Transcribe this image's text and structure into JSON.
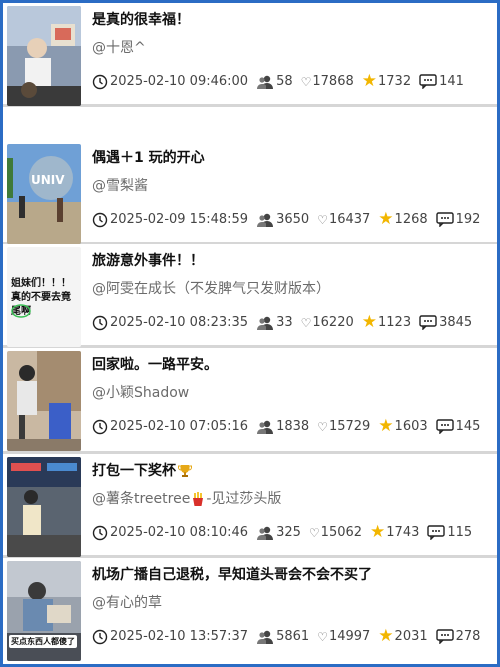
{
  "posts": [
    {
      "title": "是真的很幸福！",
      "author": "@十恩^",
      "time": "2025-02-10 09:46:00",
      "followers": "58",
      "likes": "17868",
      "stars": "1732",
      "comments": "141"
    },
    {
      "title": "偶遇＋1 玩的开心",
      "author": "@雪梨酱",
      "time": "2025-02-09 15:48:59",
      "followers": "3650",
      "likes": "16437",
      "stars": "1268",
      "comments": "192"
    },
    {
      "title": "旅游意外事件！！",
      "author": "@阿雯在成长（不发脾气只发财版本）",
      "time": "2025-02-10 08:23:35",
      "followers": "33",
      "likes": "16220",
      "stars": "1123",
      "comments": "3845",
      "thumb_text": "姐妹们！！！真的不要去竟尾啊"
    },
    {
      "title": "回家啦。一路平安。",
      "author": "@小颖Shadow",
      "time": "2025-02-10 07:05:16",
      "followers": "1838",
      "likes": "15729",
      "stars": "1603",
      "comments": "145"
    },
    {
      "title": "打包一下奖杯",
      "author_prefix": "@薯条treetree",
      "author_suffix": "-见过莎头版",
      "time": "2025-02-10 08:10:46",
      "followers": "325",
      "likes": "15062",
      "stars": "1743",
      "comments": "115"
    },
    {
      "title": "机场广播自己退税，早知道头哥会不会不买了",
      "author": "@有心的草",
      "time": "2025-02-10 13:57:37",
      "followers": "5861",
      "likes": "14997",
      "stars": "2031",
      "comments": "278",
      "thumb_text": "买点东西人都傻了"
    }
  ],
  "icons": {
    "clock": "clock-icon",
    "followers": "people-icon",
    "likes": "heart-icon",
    "stars": "star-icon",
    "comments": "comment-icon",
    "trophy": "trophy-icon",
    "fries": "fries-icon"
  },
  "colors": {
    "frame": "#2b6cc4",
    "star": "#f2b600",
    "divider": "#d6d6d6"
  }
}
